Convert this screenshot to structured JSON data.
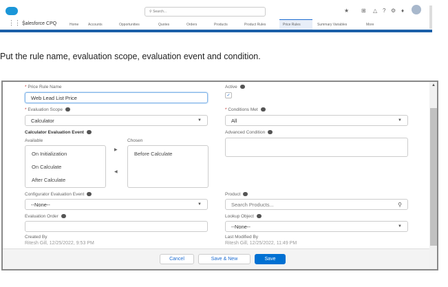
{
  "header": {
    "search_placeholder": "Search...",
    "app_name": "Salesforce CPQ",
    "nav": [
      "Home",
      "Accounts",
      "Opportunities",
      "Quotes",
      "Orders",
      "Products",
      "Product Rules",
      "Price Rules",
      "Summary Variables",
      "More"
    ],
    "active_nav": "Price Rules"
  },
  "instruction": "Put the rule name, evaluation scope, evaluation event and condition.",
  "form": {
    "price_rule_name_label": "Price Rule Name",
    "price_rule_name_value": "Web Lead List Price",
    "active_label": "Active",
    "active_checked": true,
    "evaluation_scope_label": "Evaluation Scope",
    "evaluation_scope_value": "Calculator",
    "conditions_met_label": "Conditions Met",
    "conditions_met_value": "All",
    "calc_event_label": "Calculator Evaluation Event",
    "available_label": "Available",
    "chosen_label": "Chosen",
    "available": [
      "On Initialization",
      "On Calculate",
      "After Calculate"
    ],
    "chosen": [
      "Before Calculate"
    ],
    "advanced_condition_label": "Advanced Condition",
    "advanced_condition_value": "",
    "config_event_label": "Configurator Evaluation Event",
    "config_event_value": "--None--",
    "product_label": "Product",
    "product_placeholder": "Search Products...",
    "evaluation_order_label": "Evaluation Order",
    "evaluation_order_value": "",
    "lookup_object_label": "Lookup Object",
    "lookup_object_value": "--None--",
    "created_by_label": "Created By",
    "created_by_value": "Ritesh Gill, 12/25/2022, 9:53 PM",
    "last_modified_label": "Last Modified By",
    "last_modified_value": "Ritesh Gill, 12/25/2022, 11:49 PM"
  },
  "footer": {
    "cancel": "Cancel",
    "save_new": "Save & New",
    "save": "Save"
  },
  "colors": {
    "brand": "#1b96d8",
    "primary_button": "#0070d2",
    "required": "#c23934"
  }
}
